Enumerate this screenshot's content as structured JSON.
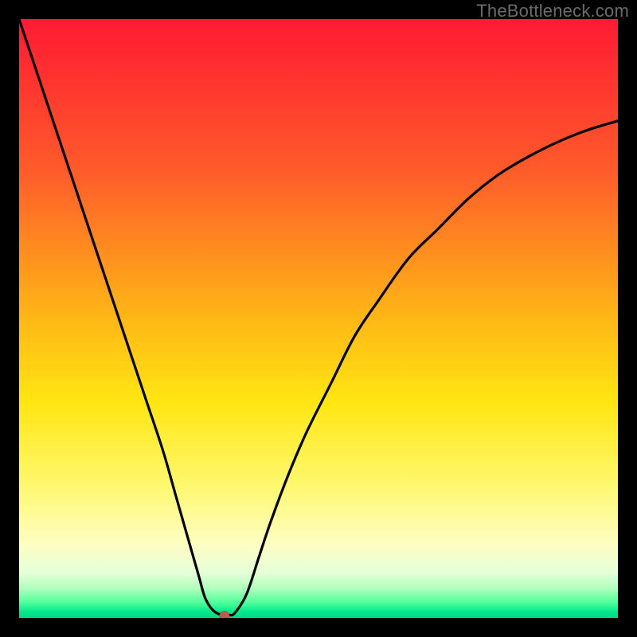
{
  "watermark": "TheBottleneck.com",
  "colors": {
    "background": "#000000",
    "curve": "#000000",
    "marker_fill": "#c0594f",
    "marker_stroke": "#b74a41",
    "gradient_top": "#ff1a33",
    "gradient_bottom": "#00db86"
  },
  "chart_data": {
    "type": "line",
    "title": "",
    "xlabel": "",
    "ylabel": "",
    "xlim": [
      0,
      100
    ],
    "ylim": [
      0,
      100
    ],
    "legend": false,
    "x": [
      0,
      3,
      6,
      9,
      12,
      15,
      18,
      21,
      24,
      26,
      28,
      30,
      31,
      32,
      33,
      34,
      35,
      36,
      38,
      40,
      42,
      45,
      48,
      52,
      56,
      60,
      65,
      70,
      75,
      80,
      85,
      90,
      95,
      100
    ],
    "y": [
      100,
      91,
      82,
      73,
      64,
      55,
      46,
      37,
      28,
      21,
      14,
      7,
      3.5,
      1.7,
      0.8,
      0.5,
      0.5,
      0.8,
      4,
      10,
      16,
      24,
      31,
      39,
      47,
      53,
      60,
      65,
      70,
      74,
      77,
      79.5,
      81.5,
      83
    ],
    "marker": {
      "x": 34.3,
      "y": 0.3
    },
    "annotations": []
  }
}
